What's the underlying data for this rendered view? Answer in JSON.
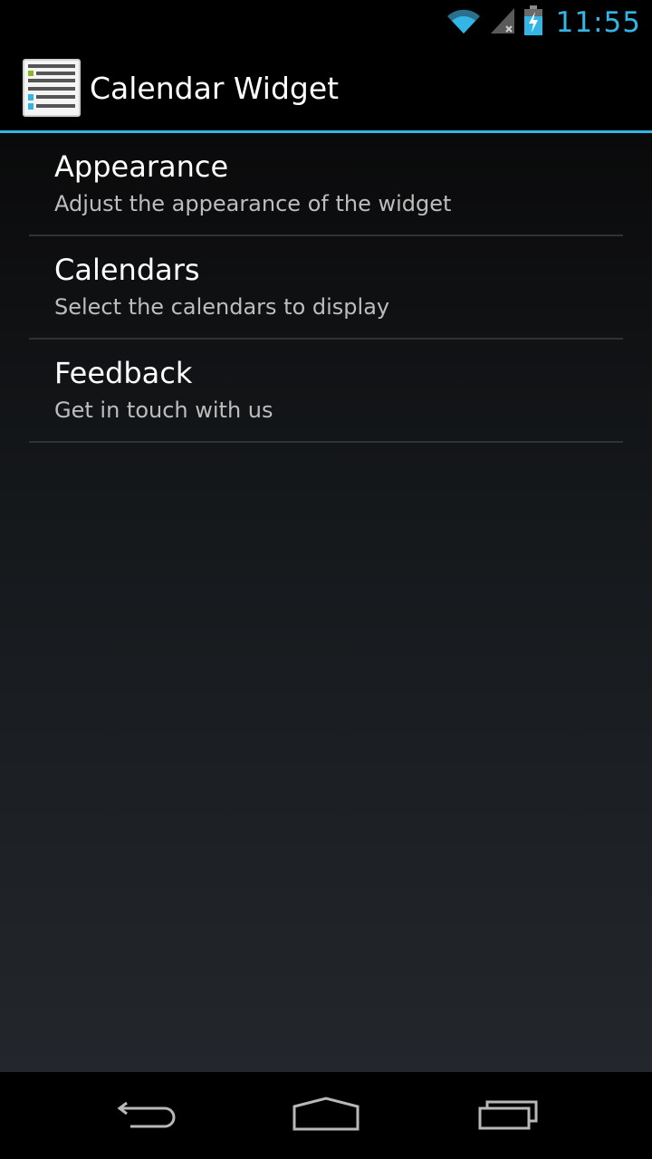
{
  "status_bar": {
    "time": "11:55",
    "icons": [
      "wifi-icon",
      "cell-signal-icon",
      "battery-charging-icon"
    ],
    "accent_color": "#33b5e5"
  },
  "action_bar": {
    "title": "Calendar Widget",
    "icon": "calendar-widget-app-icon"
  },
  "preferences": [
    {
      "title": "Appearance",
      "summary": "Adjust the appearance of the widget"
    },
    {
      "title": "Calendars",
      "summary": "Select the calendars to display"
    },
    {
      "title": "Feedback",
      "summary": "Get in touch with us"
    }
  ],
  "nav_bar": {
    "buttons": [
      "back-icon",
      "home-icon",
      "recents-icon"
    ]
  }
}
